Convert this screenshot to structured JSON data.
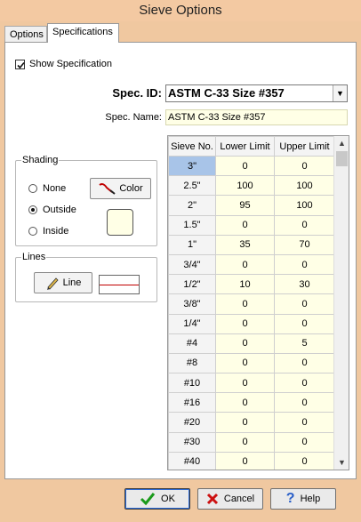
{
  "window": {
    "title": "Sieve Options"
  },
  "tabs": [
    {
      "label": "Options",
      "active": false
    },
    {
      "label": "Specifications",
      "active": true
    }
  ],
  "show_spec": {
    "label": "Show Specification",
    "checked": true
  },
  "spec_id": {
    "label": "Spec. ID:",
    "value": "ASTM C-33 Size #357"
  },
  "spec_name": {
    "label": "Spec. Name:",
    "value": "ASTM C-33 Size #357"
  },
  "shading": {
    "title": "Shading",
    "options": [
      {
        "label": "None",
        "selected": false
      },
      {
        "label": "Outside",
        "selected": true
      },
      {
        "label": "Inside",
        "selected": false
      }
    ],
    "color_button": "Color",
    "color_value": "#ffffe6"
  },
  "lines": {
    "title": "Lines",
    "line_button": "Line",
    "line_color": "#c00000"
  },
  "table": {
    "columns": [
      "Sieve No.",
      "Lower Limit",
      "Upper Limit"
    ],
    "rows": [
      [
        "3\"",
        "0",
        "0"
      ],
      [
        "2.5\"",
        "100",
        "100"
      ],
      [
        "2\"",
        "95",
        "100"
      ],
      [
        "1.5\"",
        "0",
        "0"
      ],
      [
        "1\"",
        "35",
        "70"
      ],
      [
        "3/4\"",
        "0",
        "0"
      ],
      [
        "1/2\"",
        "10",
        "30"
      ],
      [
        "3/8\"",
        "0",
        "0"
      ],
      [
        "1/4\"",
        "0",
        "0"
      ],
      [
        "#4",
        "0",
        "5"
      ],
      [
        "#8",
        "0",
        "0"
      ],
      [
        "#10",
        "0",
        "0"
      ],
      [
        "#16",
        "0",
        "0"
      ],
      [
        "#20",
        "0",
        "0"
      ],
      [
        "#30",
        "0",
        "0"
      ],
      [
        "#40",
        "0",
        "0"
      ]
    ]
  },
  "footer": {
    "ok": "OK",
    "cancel": "Cancel",
    "help": "Help"
  }
}
